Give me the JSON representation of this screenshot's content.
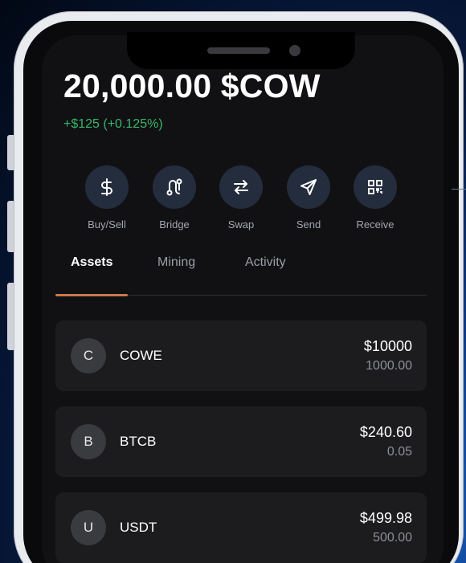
{
  "header": {
    "balance": "20,000.00 $COW",
    "change": "+$125 (+0.125%)"
  },
  "actions": [
    {
      "label": "Buy/Sell",
      "icon": "dollar-icon"
    },
    {
      "label": "Bridge",
      "icon": "bridge-icon"
    },
    {
      "label": "Swap",
      "icon": "swap-arrows-icon"
    },
    {
      "label": "Send",
      "icon": "paper-plane-icon"
    },
    {
      "label": "Receive",
      "icon": "qr-code-icon"
    }
  ],
  "tabs": [
    {
      "label": "Assets",
      "active": true
    },
    {
      "label": "Mining",
      "active": false
    },
    {
      "label": "Activity",
      "active": false
    }
  ],
  "assets": [
    {
      "initial": "C",
      "name": "COWE",
      "value": "$10000",
      "quantity": "1000.00"
    },
    {
      "initial": "B",
      "name": "BTCB",
      "value": "$240.60",
      "quantity": "0.05"
    },
    {
      "initial": "U",
      "name": "USDT",
      "value": "$499.98",
      "quantity": "500.00"
    }
  ],
  "colors": {
    "positive": "#39b66a",
    "tab_accent": "#c87a4b",
    "action_circle": "#242d3d",
    "card_bg": "#1c1c1f"
  }
}
